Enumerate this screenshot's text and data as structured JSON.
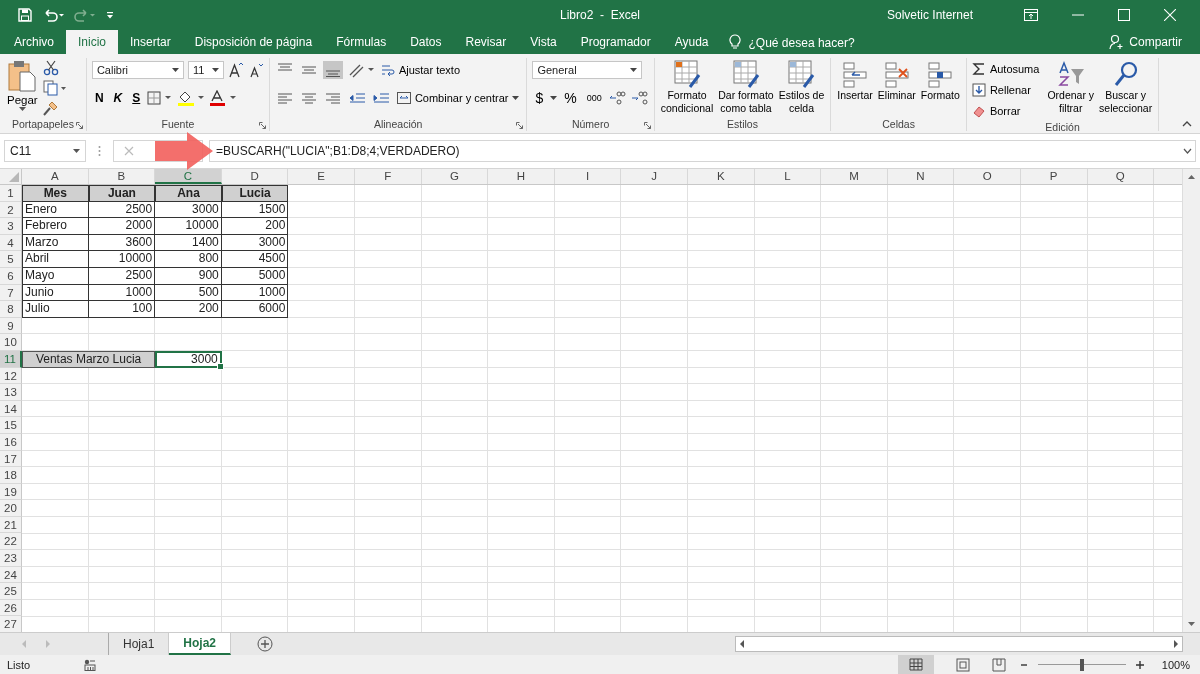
{
  "title_bar": {
    "title": "Libro2  -  Excel",
    "user": "Solvetic Internet"
  },
  "menu_tabs": [
    {
      "label": "Archivo",
      "selected": false
    },
    {
      "label": "Inicio",
      "selected": true
    },
    {
      "label": "Insertar",
      "selected": false
    },
    {
      "label": "Disposición de página",
      "selected": false
    },
    {
      "label": "Fórmulas",
      "selected": false
    },
    {
      "label": "Datos",
      "selected": false
    },
    {
      "label": "Revisar",
      "selected": false
    },
    {
      "label": "Vista",
      "selected": false
    },
    {
      "label": "Programador",
      "selected": false
    },
    {
      "label": "Ayuda",
      "selected": false
    }
  ],
  "tell_me": "¿Qué desea hacer?",
  "share": "Compartir",
  "ribbon": {
    "clipboard": {
      "label": "Portapapeles",
      "paste": "Pegar"
    },
    "font": {
      "label": "Fuente",
      "family": "Calibri",
      "size": "11",
      "bold": "N",
      "italic": "K",
      "underline": "S"
    },
    "alignment": {
      "label": "Alineación",
      "wrap": "Ajustar texto",
      "merge": "Combinar y centrar"
    },
    "number": {
      "label": "Número",
      "format": "General",
      "currency": "$",
      "percent": "%",
      "thousands": "000"
    },
    "styles": {
      "label": "Estilos",
      "buttons": [
        {
          "lines": [
            "Formato",
            "condicional"
          ]
        },
        {
          "lines": [
            "Dar formato",
            "como tabla"
          ]
        },
        {
          "lines": [
            "Estilos de",
            "celda"
          ]
        }
      ]
    },
    "cells": {
      "label": "Celdas",
      "buttons": [
        "Insertar",
        "Eliminar",
        "Formato"
      ]
    },
    "editing": {
      "label": "Edición",
      "small": [
        "Autosuma",
        "Rellenar",
        "Borrar"
      ],
      "big": [
        {
          "lines": [
            "Ordenar y",
            "filtrar"
          ]
        },
        {
          "lines": [
            "Buscar y",
            "seleccionar"
          ]
        }
      ]
    }
  },
  "formula_bar": {
    "name_box": "C11",
    "formula": "=BUSCARH(\"LUCIA\";B1:D8;4;VERDADERO)"
  },
  "sheet": {
    "columns": [
      {
        "letter": "A",
        "selected": false
      },
      {
        "letter": "B",
        "selected": false
      },
      {
        "letter": "C",
        "selected": true
      },
      {
        "letter": "D",
        "selected": false
      },
      {
        "letter": "E",
        "selected": false
      },
      {
        "letter": "F",
        "selected": false
      },
      {
        "letter": "G",
        "selected": false
      },
      {
        "letter": "H",
        "selected": false
      },
      {
        "letter": "I",
        "selected": false
      },
      {
        "letter": "J",
        "selected": false
      },
      {
        "letter": "K",
        "selected": false
      },
      {
        "letter": "L",
        "selected": false
      },
      {
        "letter": "M",
        "selected": false
      },
      {
        "letter": "N",
        "selected": false
      },
      {
        "letter": "O",
        "selected": false
      },
      {
        "letter": "P",
        "selected": false
      },
      {
        "letter": "Q",
        "selected": false
      }
    ],
    "rows": [
      {
        "number": "1",
        "selected": false,
        "cells": [
          {
            "kind": "header",
            "text": "Mes",
            "selected": false
          },
          {
            "kind": "header",
            "text": "Juan",
            "selected": false
          },
          {
            "kind": "header",
            "text": "Ana",
            "selected": false
          },
          {
            "kind": "header",
            "text": "Lucia",
            "selected": false
          }
        ]
      },
      {
        "number": "2",
        "selected": false,
        "cells": [
          {
            "kind": "text",
            "text": "Enero",
            "selected": false
          },
          {
            "kind": "number",
            "text": "2500",
            "selected": false
          },
          {
            "kind": "number",
            "text": "3000",
            "selected": false
          },
          {
            "kind": "number",
            "text": "1500",
            "selected": false
          }
        ]
      },
      {
        "number": "3",
        "selected": false,
        "cells": [
          {
            "kind": "text",
            "text": "Febrero",
            "selected": false
          },
          {
            "kind": "number",
            "text": "2000",
            "selected": false
          },
          {
            "kind": "number",
            "text": "10000",
            "selected": false
          },
          {
            "kind": "number",
            "text": "200",
            "selected": false
          }
        ]
      },
      {
        "number": "4",
        "selected": false,
        "cells": [
          {
            "kind": "text",
            "text": "Marzo",
            "selected": false
          },
          {
            "kind": "number",
            "text": "3600",
            "selected": false
          },
          {
            "kind": "number",
            "text": "1400",
            "selected": false
          },
          {
            "kind": "number",
            "text": "3000",
            "selected": false
          }
        ]
      },
      {
        "number": "5",
        "selected": false,
        "cells": [
          {
            "kind": "text",
            "text": "Abril",
            "selected": false
          },
          {
            "kind": "number",
            "text": "10000",
            "selected": false
          },
          {
            "kind": "number",
            "text": "800",
            "selected": false
          },
          {
            "kind": "number",
            "text": "4500",
            "selected": false
          }
        ]
      },
      {
        "number": "6",
        "selected": false,
        "cells": [
          {
            "kind": "text",
            "text": "Mayo",
            "selected": false
          },
          {
            "kind": "number",
            "text": "2500",
            "selected": false
          },
          {
            "kind": "number",
            "text": "900",
            "selected": false
          },
          {
            "kind": "number",
            "text": "5000",
            "selected": false
          }
        ]
      },
      {
        "number": "7",
        "selected": false,
        "cells": [
          {
            "kind": "text",
            "text": "Junio",
            "selected": false
          },
          {
            "kind": "number",
            "text": "1000",
            "selected": false
          },
          {
            "kind": "number",
            "text": "500",
            "selected": false
          },
          {
            "kind": "number",
            "text": "1000",
            "selected": false
          }
        ]
      },
      {
        "number": "8",
        "selected": false,
        "cells": [
          {
            "kind": "text",
            "text": "Julio",
            "selected": false
          },
          {
            "kind": "number",
            "text": "100",
            "selected": false
          },
          {
            "kind": "number",
            "text": "200",
            "selected": false
          },
          {
            "kind": "number",
            "text": "6000",
            "selected": false
          }
        ]
      },
      {
        "number": "9",
        "selected": false
      },
      {
        "number": "10",
        "selected": false
      },
      {
        "number": "11",
        "selected": true,
        "cells": [
          {
            "kind": "merged-label",
            "text": "Ventas Marzo Lucia",
            "selected": false
          },
          {
            "kind": "plain-number",
            "text": "3000",
            "selected": true
          }
        ]
      },
      {
        "number": "12",
        "selected": false
      },
      {
        "number": "13",
        "selected": false
      },
      {
        "number": "14",
        "selected": false
      },
      {
        "number": "15",
        "selected": false
      },
      {
        "number": "16",
        "selected": false
      },
      {
        "number": "17",
        "selected": false
      },
      {
        "number": "18",
        "selected": false
      },
      {
        "number": "19",
        "selected": false
      },
      {
        "number": "20",
        "selected": false
      },
      {
        "number": "21",
        "selected": false
      },
      {
        "number": "22",
        "selected": false
      },
      {
        "number": "23",
        "selected": false
      },
      {
        "number": "24",
        "selected": false
      },
      {
        "number": "25",
        "selected": false
      },
      {
        "number": "26",
        "selected": false
      },
      {
        "number": "27",
        "selected": false
      }
    ]
  },
  "sheet_tabs": [
    {
      "label": "Hoja1",
      "selected": false
    },
    {
      "label": "Hoja2",
      "selected": true
    }
  ],
  "status_bar": {
    "state": "Listo",
    "zoom": "100%",
    "zoom_slider": {
      "level": 0.5
    }
  }
}
